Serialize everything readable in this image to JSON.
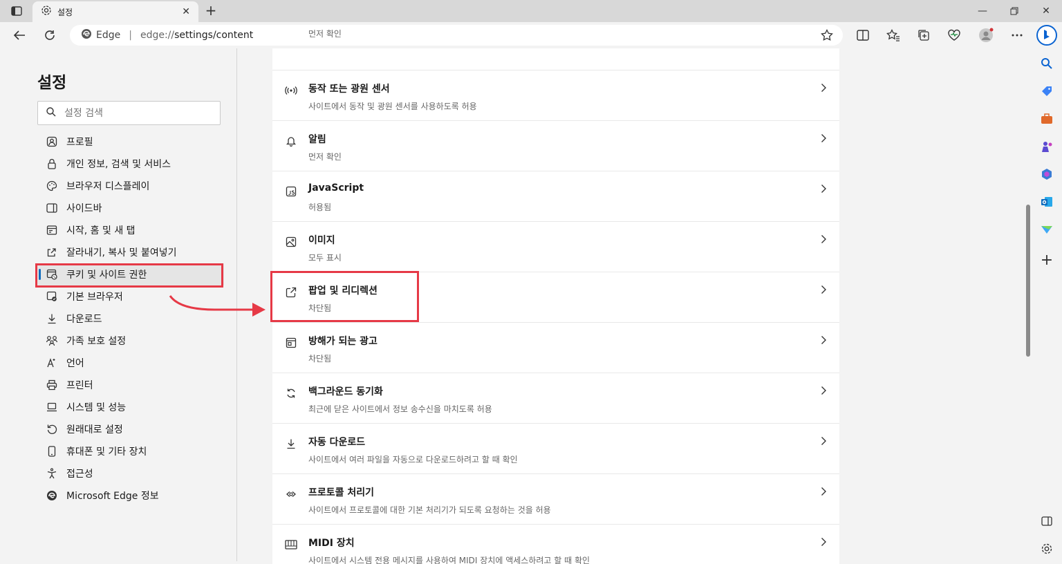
{
  "browser": {
    "tab_title": "설정",
    "address_brand": "Edge",
    "url_prefix": "edge://",
    "url_path": "settings/content"
  },
  "settings": {
    "title": "설정",
    "search_placeholder": "설정 검색",
    "nav_items": [
      {
        "label": "프로필",
        "icon": "profile-icon"
      },
      {
        "label": "개인 정보, 검색 및 서비스",
        "icon": "lock-icon"
      },
      {
        "label": "브라우저 디스플레이",
        "icon": "palette-icon"
      },
      {
        "label": "사이드바",
        "icon": "sidebar-icon"
      },
      {
        "label": "시작, 홈 및 새 탭",
        "icon": "home-tab-icon"
      },
      {
        "label": "잘라내기, 복사 및 붙여넣기",
        "icon": "share-icon"
      },
      {
        "label": "쿠키 및 사이트 권한",
        "icon": "cookie-site-icon"
      },
      {
        "label": "기본 브라우저",
        "icon": "browser-icon"
      },
      {
        "label": "다운로드",
        "icon": "download-icon"
      },
      {
        "label": "가족 보호 설정",
        "icon": "family-icon"
      },
      {
        "label": "언어",
        "icon": "language-icon"
      },
      {
        "label": "프린터",
        "icon": "printer-icon"
      },
      {
        "label": "시스템 및 성능",
        "icon": "laptop-icon"
      },
      {
        "label": "원래대로 설정",
        "icon": "reset-icon"
      },
      {
        "label": "휴대폰 및 기타 장치",
        "icon": "phone-icon"
      },
      {
        "label": "접근성",
        "icon": "accessibility-icon"
      },
      {
        "label": "Microsoft Edge 정보",
        "icon": "edge-logo-icon"
      }
    ],
    "active_index": 6
  },
  "content": {
    "top_partial_sub": "먼저 확인",
    "rows": [
      {
        "title": "동작 또는 광원 센서",
        "sub": "사이트에서 동작 및 광원 센서를 사용하도록 허용",
        "icon": "sensor-icon"
      },
      {
        "title": "알림",
        "sub": "먼저 확인",
        "icon": "bell-icon"
      },
      {
        "title": "JavaScript",
        "sub": "허용됨",
        "icon": "javascript-icon"
      },
      {
        "title": "이미지",
        "sub": "모두 표시",
        "icon": "image-icon"
      },
      {
        "title": "팝업 및 리디렉션",
        "sub": "차단됨",
        "icon": "popup-icon"
      },
      {
        "title": "방해가 되는 광고",
        "sub": "차단됨",
        "icon": "ad-icon"
      },
      {
        "title": "백그라운드 동기화",
        "sub": "최근에 닫은 사이트에서 정보 송수신을 마치도록 허용",
        "icon": "sync-icon"
      },
      {
        "title": "자동 다운로드",
        "sub": "사이트에서 여러 파일을 자동으로 다운로드하려고 할 때 확인",
        "icon": "download-icon"
      },
      {
        "title": "프로토콜 처리기",
        "sub": "사이트에서 프로토콜에 대한 기본 처리기가 되도록 요청하는 것을 허용",
        "icon": "protocol-icon"
      },
      {
        "title": "MIDI 장치",
        "sub": "사이트에서 시스템 전용 메시지를 사용하여 MIDI 장치에 액세스하려고 할 때 확인",
        "icon": "midi-icon"
      }
    ]
  },
  "colors": {
    "highlight": "#e63946",
    "accent": "#0f6cbd"
  }
}
